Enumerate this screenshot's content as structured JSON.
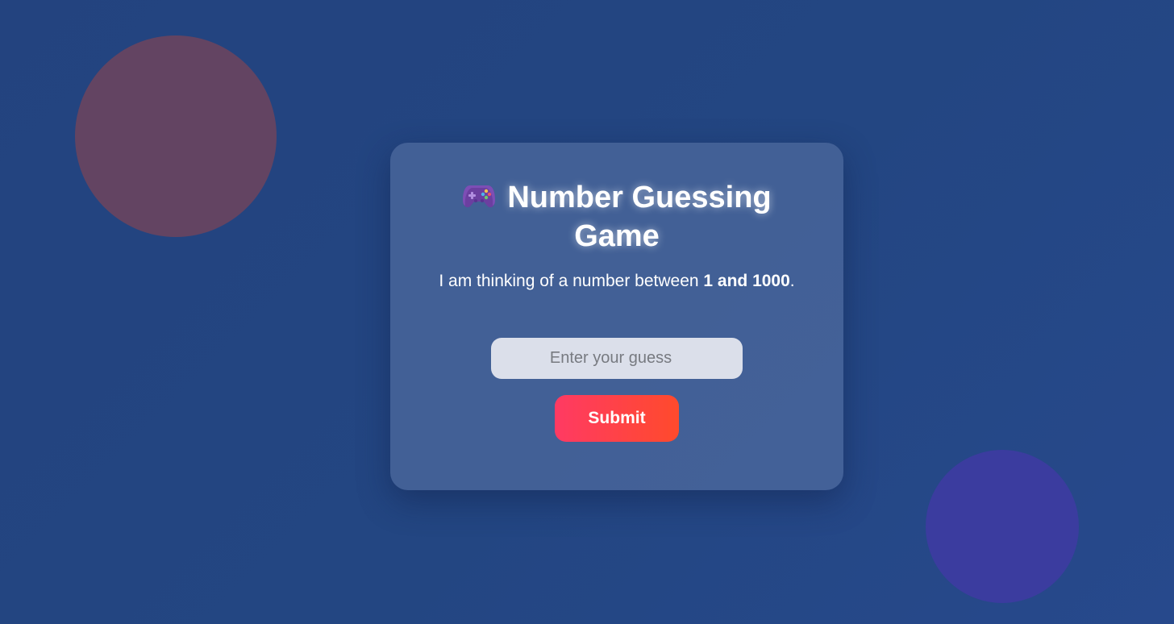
{
  "game": {
    "icon": "gamepad-icon",
    "title": "Number Guessing Game",
    "subtitle_prefix": "I am thinking of a number between ",
    "subtitle_range": "1 and 1000",
    "subtitle_suffix": ".",
    "input_placeholder": "Enter your guess",
    "input_value": "",
    "submit_label": "Submit"
  },
  "colors": {
    "background": "#23437f",
    "card": "#3f5d96",
    "button_start": "#ff3a63",
    "button_end": "#ff4a2c",
    "blob_pink": "#634462",
    "blob_purple": "#3b3c9f"
  }
}
